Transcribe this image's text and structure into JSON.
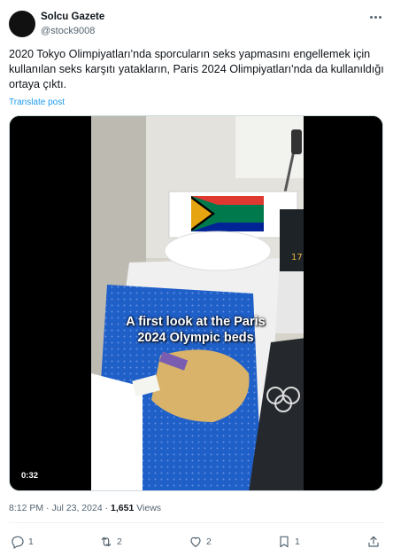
{
  "author": {
    "display_name": "Solcu Gazete",
    "handle": "@stock9008"
  },
  "post": {
    "text": "2020 Tokyo Olimpiyatları'nda sporcuların seks yapmasını engellemek için kullanılan seks karşıtı yatakların, Paris 2024 Olimpiyatları'nda da kullanıldığı ortaya çıktı.",
    "translate_label": "Translate post"
  },
  "video": {
    "duration": "0:32",
    "caption": "A first look at the Paris\n2024 Olympic beds",
    "jersey_number": "17"
  },
  "meta": {
    "time": "8:12 PM",
    "separator": "·",
    "date": "Jul 23, 2024",
    "views_count": "1,651",
    "views_label": "Views"
  },
  "actions": {
    "replies": "1",
    "reposts": "2",
    "likes": "2",
    "bookmarks": "1"
  },
  "icons": [
    "more-icon",
    "reply-icon",
    "repost-icon",
    "like-icon",
    "bookmark-icon",
    "share-icon"
  ],
  "colors": {
    "link": "#1d9bf0",
    "secondary_text": "#536471",
    "primary_text": "#0f1419",
    "duvet_blue": "#1f5fc8",
    "duvet_gold": "#d9b36a"
  }
}
